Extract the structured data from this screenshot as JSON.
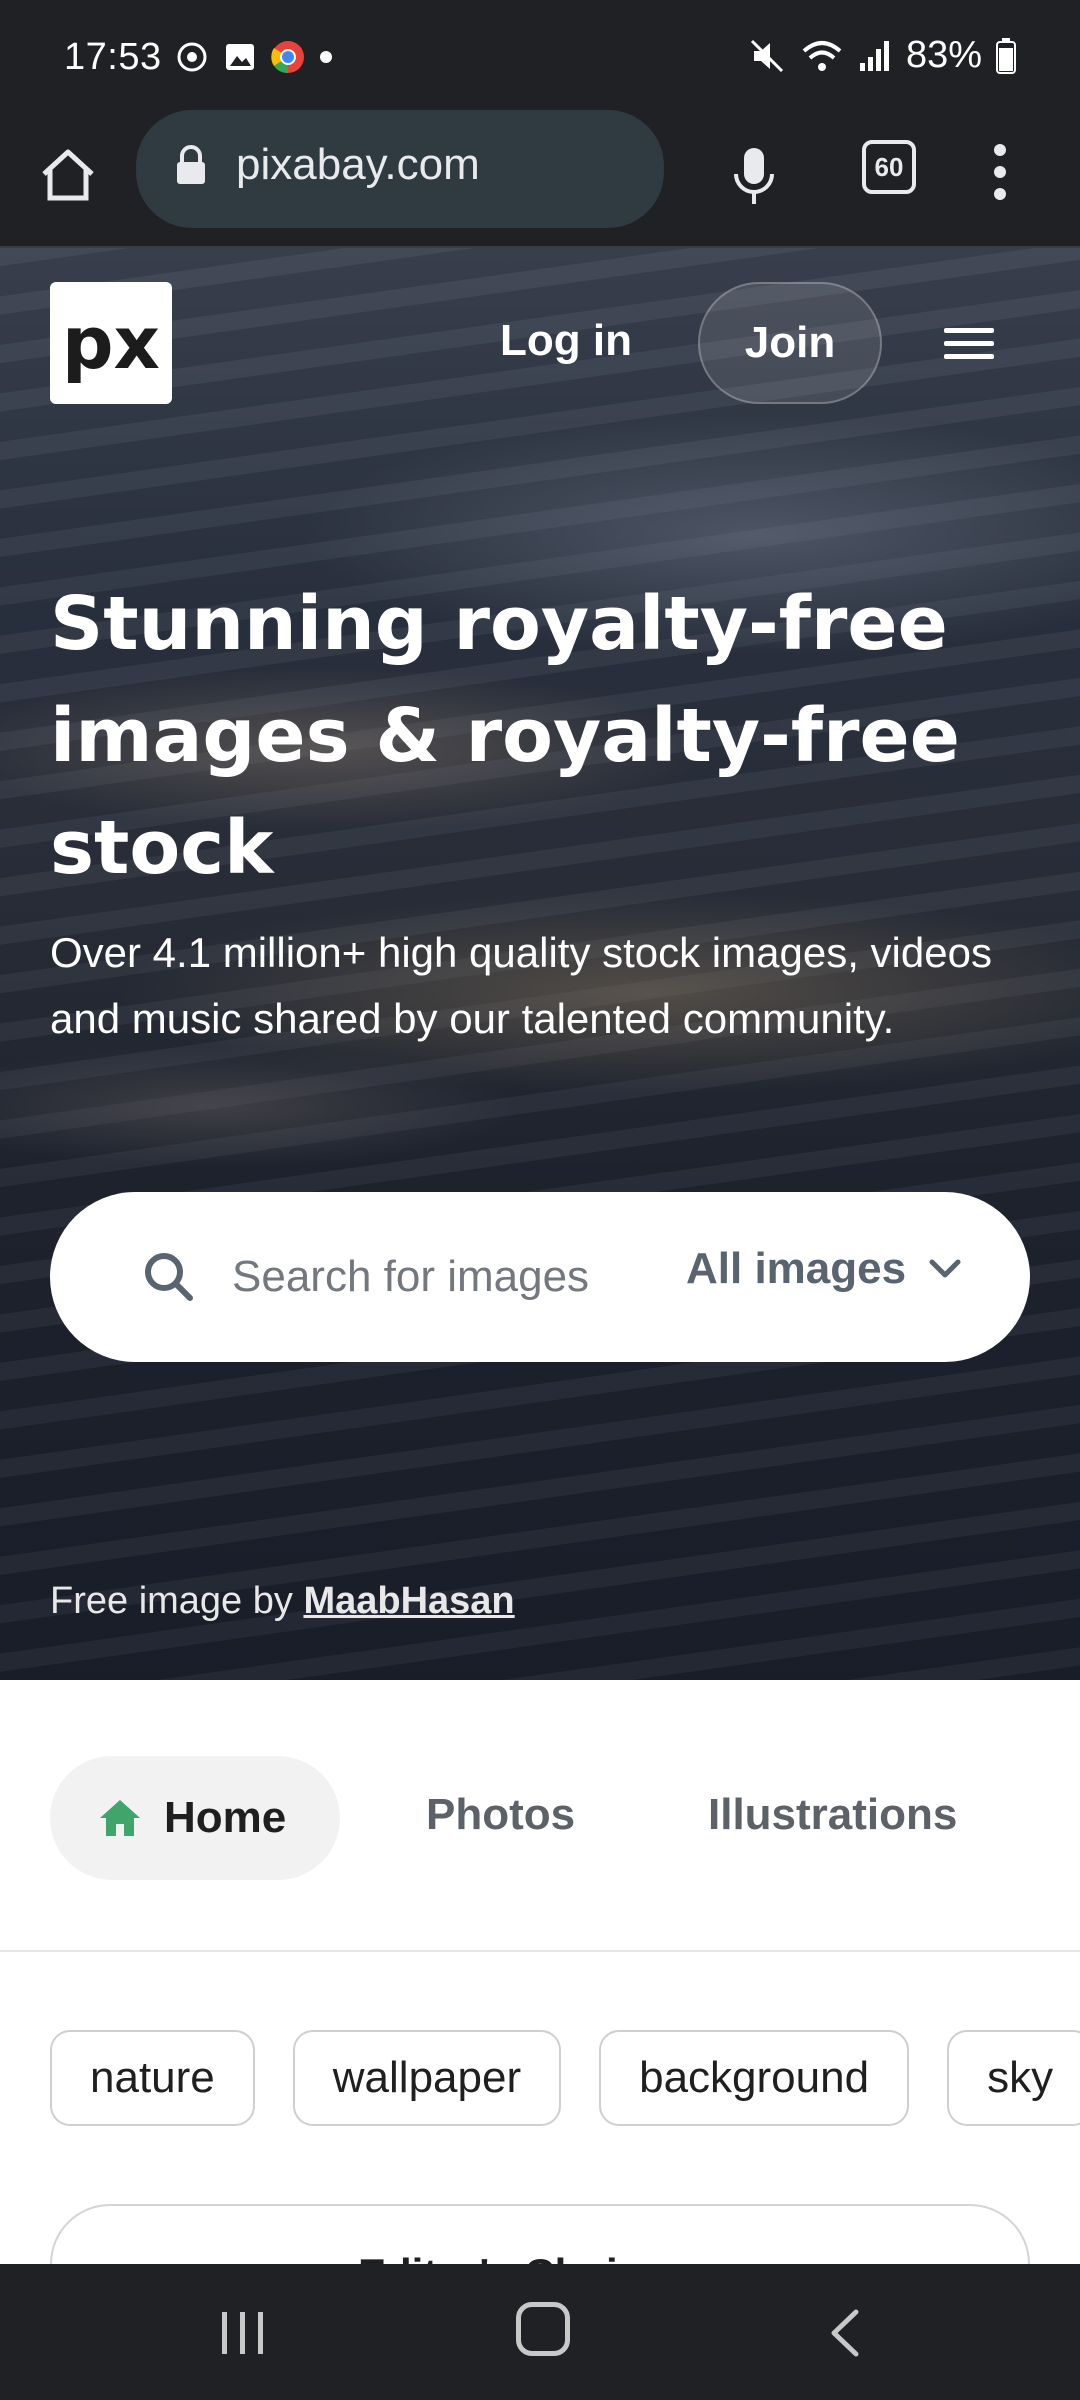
{
  "status_bar": {
    "time": "17:53",
    "battery": "83%",
    "notification_icons": [
      "screen-recorder-icon",
      "gallery-icon",
      "chrome-icon",
      "dot-icon"
    ],
    "system_icons": [
      "mute-icon",
      "wifi-icon",
      "signal-icon",
      "battery-icon"
    ]
  },
  "browser": {
    "url": "pixabay.com",
    "tab_count": "60"
  },
  "header": {
    "logo_text": "px",
    "login_label": "Log in",
    "join_label": "Join"
  },
  "hero": {
    "headline": "Stunning royalty-free images & royalty-free stock",
    "subheadline": "Over 4.1 million+ high quality stock images, videos and music shared by our talented community.",
    "search_placeholder": "Search for images",
    "filter_label": "All images",
    "credit_prefix": "Free image by ",
    "credit_author": "MaabHasan"
  },
  "nav_tabs": [
    {
      "label": "Home",
      "active": true
    },
    {
      "label": "Photos"
    },
    {
      "label": "Illustrations"
    }
  ],
  "tags": [
    "nature",
    "wallpaper",
    "background",
    "sky"
  ],
  "editors_choice_label": "Editor's Choice",
  "colors": {
    "brand_green": "#3fa56b",
    "chrome_bg": "#202124",
    "url_field": "#2f3b41"
  }
}
